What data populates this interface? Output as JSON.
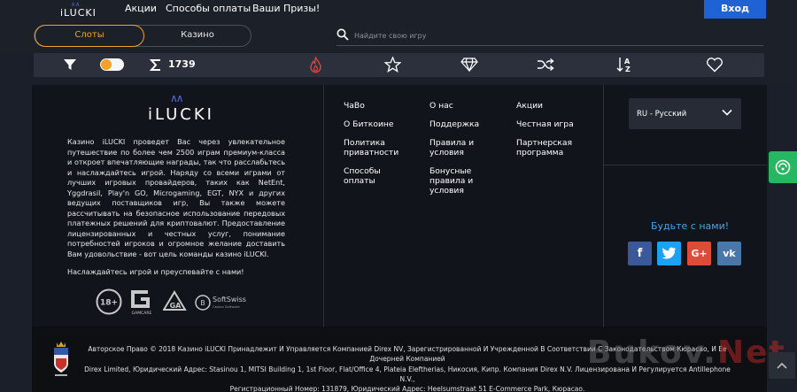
{
  "header": {
    "logo_text": "iLUCKI",
    "nav": [
      "Акции",
      "Способы оплаты",
      "Ваши Призы!"
    ],
    "login_label": "Вход"
  },
  "mode_toggle": {
    "active": "Слоты",
    "other": "Казино"
  },
  "search": {
    "placeholder": "Найдите свою игру"
  },
  "filterbar": {
    "games_count": "1739",
    "icons": [
      "filter-icon",
      "toggle-switch",
      "sigma-icon",
      "fire-icon",
      "star-icon",
      "diamond-icon",
      "shuffle-icon",
      "sort-az-icon",
      "heart-icon"
    ]
  },
  "footer": {
    "logo_text": "iLUCKI",
    "about": "Казино iLUCKI проведет Вас через увлекательное путешествие по более чем 2500 играм премиум-класса и откроет впечатляющие награды, так что расслабьтесь и наслаждайтесь игрой. Наряду со всеми играми от лучших игровых провайдеров, таких как NetEnt, Yggdrasil, Play'n GO, Microgaming, EGT, NYX и других ведущих поставщиков игр, Вы также можете рассчитывать на безопасное использование передовых платежных решений для криптовалют. Предоставление лицензированных и честных услуг, понимание потребностей игроков и огромное желание доставить Вам удовольствие - вот цель команды казино iLUCKI.",
    "enjoy": "Наслаждайтесь игрой и преуспевайте с нами!",
    "badges": [
      "18+",
      "GAMCARE",
      "GA",
      "SoftSwiss"
    ],
    "softswiss_sub": "Casino Software",
    "links_col1": [
      "ЧаВо",
      "О Биткоине",
      "Политика приватности",
      "Способы оплаты"
    ],
    "links_col2": [
      "О нас",
      "Поддержка",
      "Правила и условия",
      "Бонусные правила и условия"
    ],
    "links_col3": [
      "Акции",
      "Честная игра",
      "Партнерская программа"
    ],
    "language": "RU - Русский",
    "follow": "Будьте с нами!",
    "social": [
      "f",
      "t",
      "G+",
      "vk"
    ],
    "colors": {
      "facebook": "#3b5998",
      "twitter": "#1da1f2",
      "google": "#dd4b39",
      "vk": "#4a76a8"
    }
  },
  "copyright": {
    "lines": [
      "Авторское Право © 2018 Казино iLUCKI Принадлежит И Управляется Компанией Direx NV, Зарегистрированной И Учрежденной В Соответствии С Законодательством Кюрасао, И Ее Дочерней Компанией",
      "Direx Limited, Юридический Адрес: Stasinou 1, MITSI Building 1, 1st Floor, Flat/Office 4, Plateia Eleftherias, Никосия, Кипр. Компания Direx N.V. Лицензирована И Регулируется Antillephone N.V.,",
      "Регистрационный Номер: 131879, Юридический Адрес: Heelsumstraat 51 E-Commerce Park, Кюрасао."
    ],
    "watermark_a": "Bukov.",
    "watermark_b": "Net"
  }
}
